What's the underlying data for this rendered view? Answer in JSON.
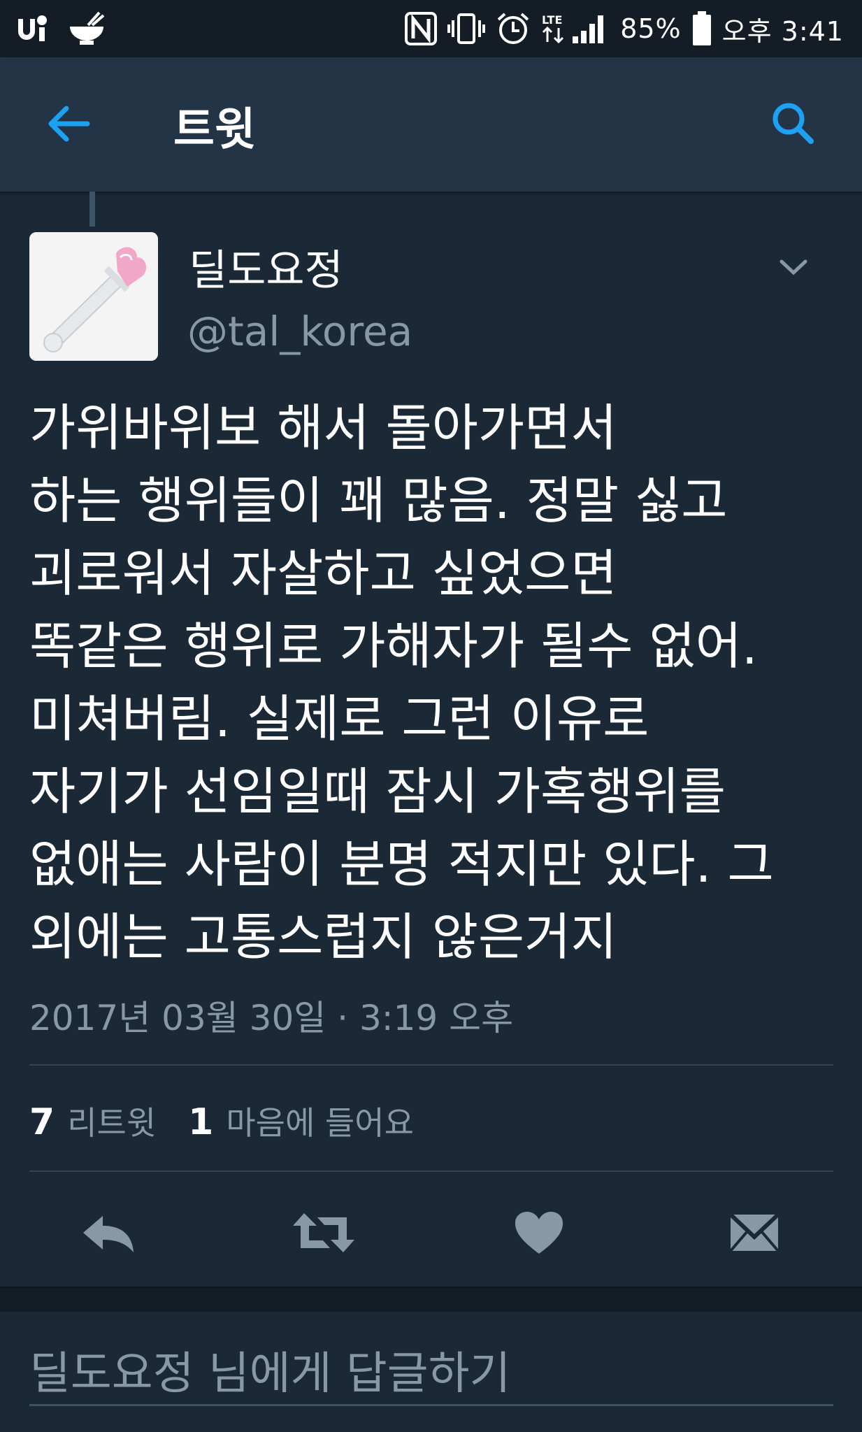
{
  "status_bar": {
    "battery": "85%",
    "time": "오후 3:41",
    "network": "LTE"
  },
  "app_bar": {
    "title": "트윗"
  },
  "tweet": {
    "author_name": "딜도요정",
    "author_handle": "@tal_korea",
    "text": "가위바위보 해서 돌아가면서\n하는 행위들이 꽤 많음. 정말 싫고\n괴로워서 자살하고 싶었으면\n똑같은 행위로 가해자가 될수 없어.\n미쳐버림. 실제로 그런 이유로\n자기가 선임일때 잠시 가혹행위를\n없애는 사람이 분명 적지만 있다. 그\n외에는 고통스럽지 않은거지",
    "timestamp": "2017년 03월 30일 · 3:19 오후",
    "retweet_count": "7",
    "retweet_label": "리트윗",
    "like_count": "1",
    "like_label": "마음에 들어요"
  },
  "reply": {
    "placeholder": "딜도요정 님에게 답글하기"
  },
  "colors": {
    "background": "#1b2836",
    "app_bar": "#243447",
    "status_bar": "#141d26",
    "accent": "#1da1f2",
    "secondary_text": "#8899a6",
    "icon_gray": "#8899a6"
  },
  "icons": {
    "back": "arrow-left-icon",
    "search": "search-icon",
    "caret": "chevron-down-icon",
    "reply": "reply-icon",
    "retweet": "retweet-icon",
    "like": "heart-icon",
    "dm": "envelope-icon"
  }
}
